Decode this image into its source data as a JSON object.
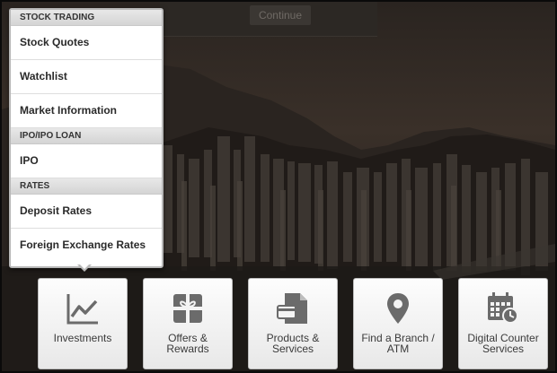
{
  "background": {
    "continue_label": "Continue"
  },
  "menu": {
    "sections": [
      {
        "title": "STOCK TRADING",
        "items": [
          "Stock Quotes",
          "Watchlist",
          "Market Information"
        ]
      },
      {
        "title": "IPO/IPO LOAN",
        "items": [
          "IPO"
        ]
      },
      {
        "title": "RATES",
        "items": [
          "Deposit Rates",
          "Foreign Exchange Rates"
        ]
      }
    ]
  },
  "tiles": [
    {
      "label": "Investments",
      "icon": "chart-line-icon"
    },
    {
      "label": "Offers & Rewards",
      "icon": "gift-icon"
    },
    {
      "label": "Products & Services",
      "icon": "document-card-icon"
    },
    {
      "label": "Find a Branch / ATM",
      "icon": "map-pin-icon"
    },
    {
      "label": "Digital Counter Services",
      "icon": "calendar-clock-icon"
    }
  ],
  "colors": {
    "icon_gray": "#6b6b6b",
    "tile_bg": "#f4f4f4",
    "menu_header_bg": "#dcdcdc"
  }
}
